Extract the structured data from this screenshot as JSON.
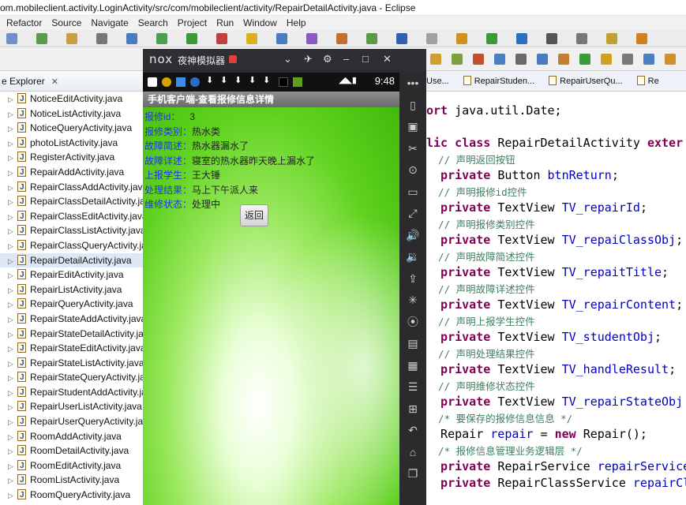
{
  "window": {
    "title": "om.mobileclient.activity.LoginActivity/src/com/mobileclient/activity/RepairDetailActivity.java - Eclipse"
  },
  "menu": [
    "Refactor",
    "Source",
    "Navigate",
    "Search",
    "Project",
    "Run",
    "Window",
    "Help"
  ],
  "explorer": {
    "tab_label": "e Explorer",
    "files": [
      "NoticeEditActivity.java",
      "NoticeListActivity.java",
      "NoticeQueryActivity.java",
      "photoListActivity.java",
      "RegisterActivity.java",
      "RepairAddActivity.java",
      "RepairClassAddActivity.java",
      "RepairClassDetailActivity.java",
      "RepairClassEditActivity.java",
      "RepairClassListActivity.java",
      "RepairClassQueryActivity.java",
      "RepairDetailActivity.java",
      "RepairEditActivity.java",
      "RepairListActivity.java",
      "RepairQueryActivity.java",
      "RepairStateAddActivity.java",
      "RepairStateDetailActivity.java",
      "RepairStateEditActivity.java",
      "RepairStateListActivity.java",
      "RepairStateQueryActivity.java",
      "RepairStudentAddActivity.java",
      "RepairUserListActivity.java",
      "RepairUserQueryActivity.java",
      "RoomAddActivity.java",
      "RoomDetailActivity.java",
      "RoomEditActivity.java",
      "RoomListActivity.java",
      "RoomQueryActivity.java"
    ],
    "selected_index": 11
  },
  "editor_tabs": [
    "Use...",
    "RepairStuden...",
    "RepairUserQu...",
    "Re"
  ],
  "code_lines": [
    {
      "parts": [
        {
          "t": "ort ",
          "c": "kw"
        },
        {
          "t": "java.util.Date;",
          "c": ""
        }
      ]
    },
    {
      "parts": [
        {
          "t": "",
          "c": ""
        }
      ]
    },
    {
      "parts": [
        {
          "t": "lic ",
          "c": "kw"
        },
        {
          "t": "class ",
          "c": "kw"
        },
        {
          "t": "RepairDetailActivity ",
          "c": ""
        },
        {
          "t": "exter",
          "c": "kw"
        }
      ]
    },
    {
      "parts": [
        {
          "t": "  // 声明返回按钮",
          "c": "cm"
        }
      ]
    },
    {
      "parts": [
        {
          "t": "  private ",
          "c": "kw"
        },
        {
          "t": "Button ",
          "c": ""
        },
        {
          "t": "btnReturn",
          "c": "fd"
        },
        {
          "t": ";",
          "c": ""
        }
      ]
    },
    {
      "parts": [
        {
          "t": "  // 声明报修id控件",
          "c": "cm"
        }
      ]
    },
    {
      "parts": [
        {
          "t": "  private ",
          "c": "kw"
        },
        {
          "t": "TextView ",
          "c": ""
        },
        {
          "t": "TV_repairId",
          "c": "fd"
        },
        {
          "t": ";",
          "c": ""
        }
      ]
    },
    {
      "parts": [
        {
          "t": "  // 声明报修类别控件",
          "c": "cm"
        }
      ]
    },
    {
      "parts": [
        {
          "t": "  private ",
          "c": "kw"
        },
        {
          "t": "TextView ",
          "c": ""
        },
        {
          "t": "TV_repaiClassObj",
          "c": "fd"
        },
        {
          "t": ";",
          "c": ""
        }
      ]
    },
    {
      "parts": [
        {
          "t": "  // 声明故障简述控件",
          "c": "cm"
        }
      ]
    },
    {
      "parts": [
        {
          "t": "  private ",
          "c": "kw"
        },
        {
          "t": "TextView ",
          "c": ""
        },
        {
          "t": "TV_repaitTitle",
          "c": "fd"
        },
        {
          "t": ";",
          "c": ""
        }
      ]
    },
    {
      "parts": [
        {
          "t": "  // 声明故障详述控件",
          "c": "cm"
        }
      ]
    },
    {
      "parts": [
        {
          "t": "  private ",
          "c": "kw"
        },
        {
          "t": "TextView ",
          "c": ""
        },
        {
          "t": "TV_repairContent",
          "c": "fd"
        },
        {
          "t": ";",
          "c": ""
        }
      ]
    },
    {
      "parts": [
        {
          "t": "  // 声明上报学生控件",
          "c": "cm"
        }
      ]
    },
    {
      "parts": [
        {
          "t": "  private ",
          "c": "kw"
        },
        {
          "t": "TextView ",
          "c": ""
        },
        {
          "t": "TV_studentObj",
          "c": "fd"
        },
        {
          "t": ";",
          "c": ""
        }
      ]
    },
    {
      "parts": [
        {
          "t": "  // 声明处理结果控件",
          "c": "cm"
        }
      ]
    },
    {
      "parts": [
        {
          "t": "  private ",
          "c": "kw"
        },
        {
          "t": "TextView ",
          "c": ""
        },
        {
          "t": "TV_handleResult",
          "c": "fd"
        },
        {
          "t": ";",
          "c": ""
        }
      ]
    },
    {
      "parts": [
        {
          "t": "  // 声明维修状态控件",
          "c": "cm"
        }
      ]
    },
    {
      "parts": [
        {
          "t": "  private ",
          "c": "kw"
        },
        {
          "t": "TextView ",
          "c": ""
        },
        {
          "t": "TV_repairStateObj",
          "c": "fd"
        }
      ]
    },
    {
      "parts": [
        {
          "t": "  /* 要保存的报修信息信息 */",
          "c": "cm"
        }
      ]
    },
    {
      "parts": [
        {
          "t": "  Repair ",
          "c": ""
        },
        {
          "t": "repair",
          "c": "fd"
        },
        {
          "t": " = ",
          "c": ""
        },
        {
          "t": "new ",
          "c": "kw"
        },
        {
          "t": "Repair();",
          "c": ""
        }
      ]
    },
    {
      "parts": [
        {
          "t": "  /* 报修信息管理业务逻辑层 */",
          "c": "cm"
        }
      ]
    },
    {
      "parts": [
        {
          "t": "  private ",
          "c": "kw"
        },
        {
          "t": "RepairService ",
          "c": ""
        },
        {
          "t": "repairService",
          "c": "fd"
        }
      ]
    },
    {
      "parts": [
        {
          "t": "  private ",
          "c": "kw"
        },
        {
          "t": "RepairClassService ",
          "c": ""
        },
        {
          "t": "repairCl",
          "c": "fd"
        }
      ]
    }
  ],
  "emulator": {
    "logo": "nox",
    "name": "夜神模拟器",
    "controls": [
      "⌄",
      "✈",
      "⚙",
      "–",
      "□",
      "✕"
    ],
    "time": "9:48",
    "app_title": "手机客户端-查看报修信息详情",
    "fields": [
      {
        "label": "报修id：",
        "value": "3"
      },
      {
        "label": "报修类别：",
        "value": "热水类"
      },
      {
        "label": "故障简述：",
        "value": "热水器漏水了"
      },
      {
        "label": "故障详述：",
        "value": "寝室的热水器昨天晚上漏水了"
      },
      {
        "label": "上报学生：",
        "value": "王大锤"
      },
      {
        "label": "处理结果：",
        "value": "马上下午派人来"
      },
      {
        "label": "维修状态：",
        "value": "处理中"
      }
    ],
    "return_button": "返回",
    "side_icons": [
      "more-icon",
      "screenshot-icon",
      "keyboard-icon",
      "cut-icon",
      "location-icon",
      "window-icon",
      "fullscreen-icon",
      "volume-up-icon",
      "volume-down-icon",
      "apk-icon",
      "loading-icon",
      "shake-icon",
      "record-icon",
      "multi-instance-icon",
      "menu-icon",
      "add-icon",
      "back-icon",
      "home-icon",
      "recent-icon"
    ],
    "colors": {
      "label": "#1d3ad6",
      "appbar": "#7a7a7a",
      "screen_green": "#5ed21e"
    }
  }
}
